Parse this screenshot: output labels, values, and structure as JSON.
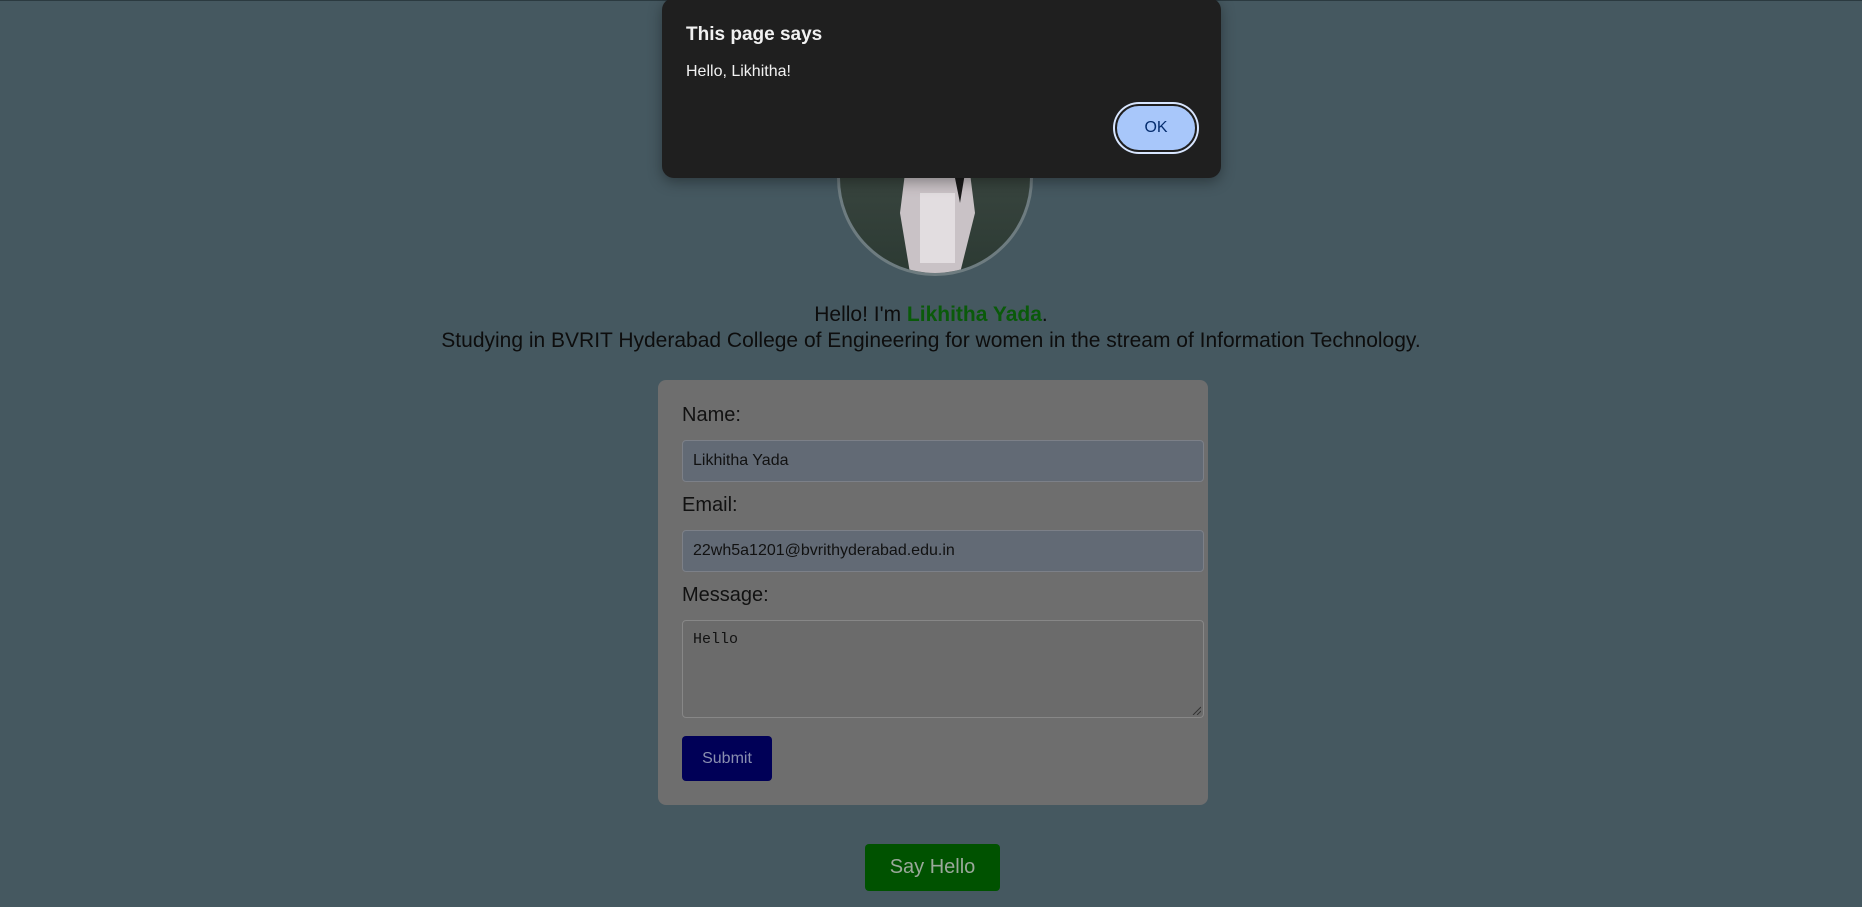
{
  "dialog": {
    "title": "This page says",
    "message": "Hello, Likhitha!",
    "ok_label": "OK"
  },
  "intro": {
    "greeting_prefix": "Hello! I'm ",
    "name": "Likhitha Yada",
    "greeting_suffix": ".",
    "description": "Studying in BVRIT Hyderabad College of Engineering for women in the stream of Information Technology."
  },
  "form": {
    "name_label": "Name:",
    "name_value": "Likhitha Yada",
    "email_label": "Email:",
    "email_value": "22wh5a1201@bvrithyderabad.edu.in",
    "message_label": "Message:",
    "message_value": "Hello",
    "submit_label": "Submit"
  },
  "say_hello_label": "Say Hello",
  "colors": {
    "page_background": "#455860",
    "name_highlight": "#0a5a0a",
    "submit_button": "#000057",
    "say_hello_button": "#005200",
    "dialog_background": "#1f1f1f",
    "ok_button": "#a8c7fa"
  }
}
